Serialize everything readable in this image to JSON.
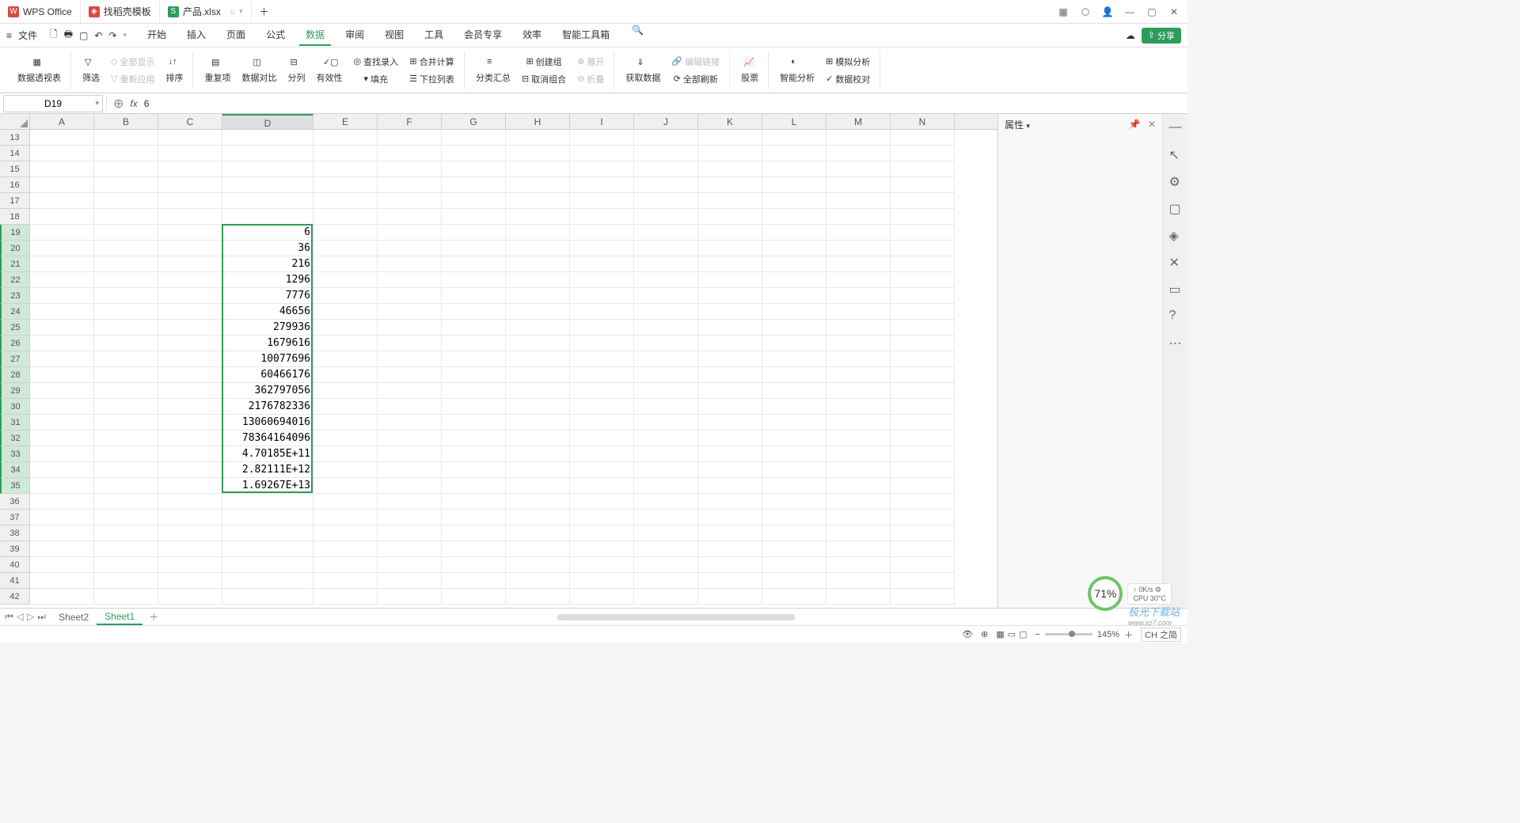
{
  "tabs": [
    {
      "icon": "wps",
      "label": "WPS Office"
    },
    {
      "icon": "doc",
      "label": "找稻壳模板"
    },
    {
      "icon": "xls",
      "label": "产品.xlsx"
    }
  ],
  "menu": {
    "file": "文件",
    "items": [
      "开始",
      "插入",
      "页面",
      "公式",
      "数据",
      "审阅",
      "视图",
      "工具",
      "会员专享",
      "效率",
      "智能工具箱"
    ],
    "active": "数据",
    "share": "分享"
  },
  "ribbon": {
    "pivot": "数据透视表",
    "filter": "筛选",
    "show_all": "全部显示",
    "refilter": "重新应用",
    "sort": "排序",
    "dedup": "重复项",
    "compare": "数据对比",
    "split": "分列",
    "validity": "有效性",
    "fill": "填充",
    "lookup": "查找录入",
    "consolidate": "合并计算",
    "dropdown": "下拉列表",
    "subtotal": "分类汇总",
    "group": "创建组",
    "ungroup": "取消组合",
    "expand": "展开",
    "collapse": "折叠",
    "import": "获取数据",
    "editlink": "编辑链接",
    "refresh": "全部刷新",
    "stock": "股票",
    "analysis": "智能分析",
    "simulate": "模拟分析",
    "validate": "数据校对"
  },
  "formula": {
    "cell_ref": "D19",
    "value": "6"
  },
  "side": {
    "title": "属性"
  },
  "columns": [
    "A",
    "B",
    "C",
    "D",
    "E",
    "F",
    "G",
    "H",
    "I",
    "J",
    "K",
    "L",
    "M",
    "N"
  ],
  "row_start": 13,
  "row_end": 42,
  "selection": {
    "col": "D",
    "row_from": 19,
    "row_to": 35
  },
  "data_col_d": {
    "19": "6",
    "20": "36",
    "21": "216",
    "22": "1296",
    "23": "7776",
    "24": "46656",
    "25": "279936",
    "26": "1679616",
    "27": "10077696",
    "28": "60466176",
    "29": "362797056",
    "30": "2176782336",
    "31": "13060694016",
    "32": "78364164096",
    "33": "4.70185E+11",
    "34": "2.82111E+12",
    "35": "1.69267E+13"
  },
  "sheets": {
    "list": [
      "Sheet2",
      "Sheet1"
    ],
    "active": "Sheet1"
  },
  "status": {
    "zoom": "145%",
    "ime": "CH 之简"
  },
  "perf": {
    "pct": "71%",
    "net": "0K/s",
    "cpu": "CPU 30°C"
  },
  "watermark": {
    "main": "极光下载站",
    "sub": "www.xz7.com"
  }
}
